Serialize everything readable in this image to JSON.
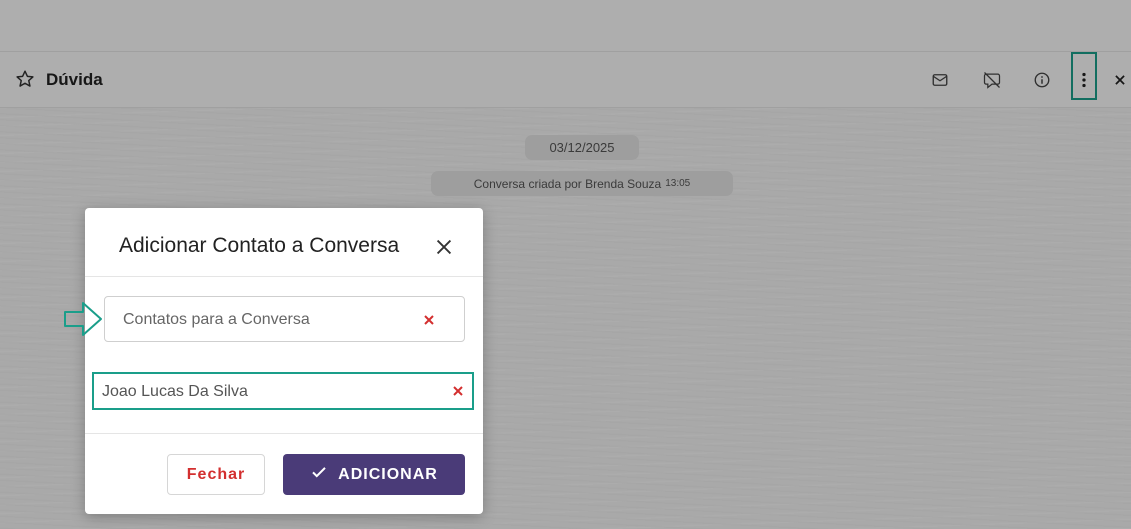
{
  "header": {
    "title": "Dúvida",
    "icons": [
      "star-outline-icon",
      "email-icon",
      "comment-slash-icon",
      "info-icon",
      "more-vertical-icon",
      "close-icon"
    ]
  },
  "chat": {
    "date": "03/12/2025",
    "created_text": "Conversa criada por Brenda Souza",
    "created_time": "13:05"
  },
  "modal": {
    "title": "Adicionar Contato a Conversa",
    "input_placeholder": "Contatos para a Conversa",
    "selected_contact": "Joao Lucas Da Silva",
    "close_label": "Fechar",
    "add_label": "ADICIONAR"
  },
  "colors": {
    "accent": "#1a9e8a",
    "primary_button": "#4a3b78",
    "danger": "#d32f2f"
  }
}
